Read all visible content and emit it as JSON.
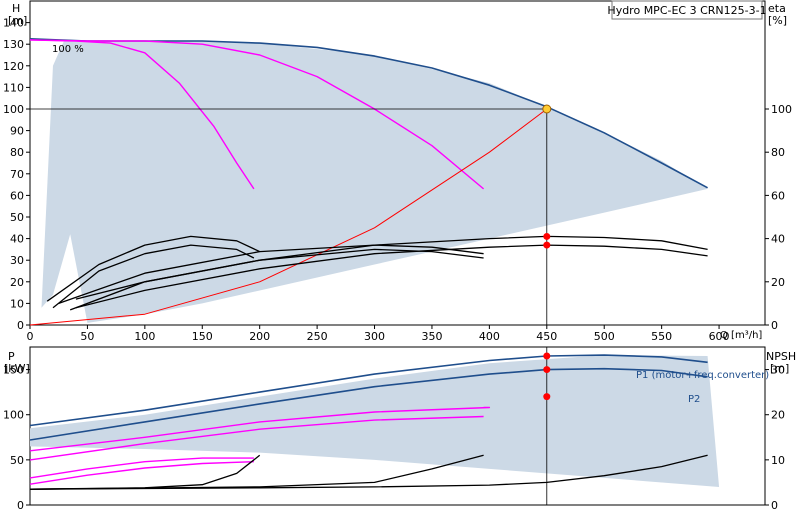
{
  "title": "Hydro MPC-EC 3 CRN125-3-1",
  "colors": {
    "area": "#ccd9e6",
    "area_light": "#e4edf5",
    "max_curve": "#1f4e8c",
    "pump_curve": "#ff00ff",
    "system_curve": "#ff0000",
    "eta_curve": "#000000",
    "op_point": "#ff0000",
    "op_fill": "#ffcc33",
    "grid": "#000000",
    "frame": "#000000"
  },
  "chart_data": [
    {
      "type": "line",
      "name": "head-chart",
      "title": "",
      "xlabel": "Q [m³/h]",
      "ylabel": "H [m]",
      "ylabel_symbol": "H",
      "ylabel_unit": "[m]",
      "y2label_symbol": "eta",
      "y2label_unit": "[%]",
      "xlim": [
        0,
        640
      ],
      "ylim": [
        0,
        150
      ],
      "y2lim": [
        0,
        150
      ],
      "x_ticks": [
        0,
        50,
        100,
        150,
        200,
        250,
        300,
        350,
        400,
        450,
        500,
        550,
        600
      ],
      "y_ticks": [
        0,
        10,
        20,
        30,
        40,
        50,
        60,
        70,
        80,
        90,
        100,
        110,
        120,
        130,
        140
      ],
      "y2_ticks": [
        0,
        20,
        40,
        60,
        80,
        100
      ],
      "annotation": "100 %",
      "operating_point": {
        "x": 450,
        "y": 100
      },
      "eta_points": [
        {
          "x": 450,
          "y": 41
        },
        {
          "x": 450,
          "y": 37
        }
      ],
      "series": [
        {
          "role": "area",
          "x": [
            10,
            20,
            30,
            100,
            150,
            200,
            300,
            400,
            450,
            500,
            550,
            590,
            500,
            400,
            300,
            200,
            150,
            100,
            50,
            35,
            20
          ],
          "y": [
            8,
            120,
            132,
            131.5,
            131.5,
            130.5,
            125,
            112,
            101,
            89,
            76,
            63,
            52,
            40,
            28,
            16,
            10,
            5,
            1,
            42,
            14
          ]
        },
        {
          "role": "max",
          "x": [
            0,
            50,
            100,
            150,
            200,
            250,
            300,
            350,
            400,
            450,
            500,
            550,
            590
          ],
          "y": [
            132.5,
            131.5,
            131.5,
            131.5,
            130.5,
            128.5,
            124.5,
            119,
            111,
            101,
            89,
            75,
            63.5
          ]
        },
        {
          "role": "pump",
          "x": [
            0,
            40,
            70,
            100,
            130,
            160,
            180,
            195
          ],
          "y": [
            132,
            131.5,
            130.5,
            126,
            112,
            92,
            75,
            63
          ]
        },
        {
          "role": "pump",
          "x": [
            0,
            50,
            100,
            150,
            200,
            250,
            300,
            350,
            395
          ],
          "y": [
            132,
            131.5,
            131.5,
            130,
            125,
            115,
            100,
            83,
            63
          ]
        },
        {
          "role": "system",
          "x": [
            0,
            100,
            200,
            300,
            400,
            450
          ],
          "y": [
            0,
            5,
            20,
            45,
            80,
            100
          ]
        },
        {
          "role": "eta",
          "x": [
            15,
            60,
            100,
            140,
            180,
            200
          ],
          "y": [
            11,
            28,
            37,
            41,
            39,
            34
          ]
        },
        {
          "role": "eta",
          "x": [
            20,
            60,
            100,
            140,
            180,
            195
          ],
          "y": [
            8,
            25,
            33,
            37,
            35,
            31
          ]
        },
        {
          "role": "eta",
          "x": [
            25,
            100,
            200,
            300,
            350,
            395
          ],
          "y": [
            10,
            24,
            34,
            37,
            36,
            33
          ]
        },
        {
          "role": "eta",
          "x": [
            35,
            100,
            200,
            300,
            350,
            395
          ],
          "y": [
            7,
            20,
            30,
            35,
            34,
            31
          ]
        },
        {
          "role": "eta",
          "x": [
            40,
            100,
            200,
            300,
            400,
            450,
            500,
            550,
            590
          ],
          "y": [
            12,
            20,
            30,
            37,
            40,
            41,
            40.5,
            39,
            35
          ]
        },
        {
          "role": "eta",
          "x": [
            40,
            100,
            200,
            300,
            400,
            450,
            500,
            550,
            590
          ],
          "y": [
            8,
            16,
            26,
            33,
            36,
            37,
            36.5,
            35,
            32
          ]
        }
      ]
    },
    {
      "type": "line",
      "name": "power-chart",
      "title": "",
      "xlabel": "",
      "ylabel": "P [kW]",
      "ylabel_symbol": "P",
      "ylabel_unit": "[kW]",
      "y2label_symbol": "NPSH",
      "y2label_unit": "[m]",
      "xlim": [
        0,
        640
      ],
      "ylim": [
        0,
        175
      ],
      "y2lim": [
        0,
        35
      ],
      "y_ticks": [
        0,
        50,
        100,
        150
      ],
      "y2_ticks": [
        0,
        10,
        20,
        30
      ],
      "series_labels": [
        "P1 (motor+freq.converter)",
        "P2"
      ],
      "operating_points": [
        {
          "x": 450,
          "y": 165
        },
        {
          "x": 450,
          "y": 150
        },
        {
          "x": 450,
          "y": 24
        }
      ],
      "series": [
        {
          "role": "area",
          "x": [
            0,
            100,
            200,
            300,
            400,
            500,
            590,
            600,
            500,
            400,
            300,
            200,
            100,
            0
          ],
          "y": [
            85,
            100,
            120,
            140,
            157,
            166,
            165,
            20,
            30,
            40,
            50,
            58,
            62,
            65
          ]
        },
        {
          "role": "max",
          "x": [
            0,
            100,
            200,
            300,
            400,
            450,
            500,
            550,
            590
          ],
          "y": [
            88,
            105,
            125,
            145,
            160,
            165,
            166,
            164,
            158
          ]
        },
        {
          "role": "max",
          "x": [
            0,
            100,
            200,
            300,
            400,
            450,
            500,
            550,
            590
          ],
          "y": [
            72,
            92,
            112,
            131,
            145,
            150,
            151,
            149,
            142
          ]
        },
        {
          "role": "pump",
          "x": [
            0,
            100,
            200,
            300,
            400,
            395
          ],
          "y": [
            60,
            75,
            92,
            103,
            108,
            108
          ]
        },
        {
          "role": "pump",
          "x": [
            0,
            100,
            200,
            300,
            395
          ],
          "y": [
            50,
            68,
            84,
            94,
            98
          ]
        },
        {
          "role": "pump",
          "x": [
            0,
            50,
            100,
            150,
            195
          ],
          "y": [
            30,
            40,
            48,
            52,
            52
          ]
        },
        {
          "role": "pump",
          "x": [
            0,
            50,
            100,
            150,
            195
          ],
          "y": [
            23,
            33,
            41,
            46,
            48
          ]
        },
        {
          "role": "npsh",
          "x": [
            0,
            100,
            150,
            180,
            200
          ],
          "y": [
            3.5,
            3.8,
            4.5,
            7,
            11
          ]
        },
        {
          "role": "npsh",
          "x": [
            0,
            200,
            300,
            350,
            395
          ],
          "y": [
            3.5,
            4,
            5,
            8,
            11
          ]
        },
        {
          "role": "npsh",
          "x": [
            0,
            200,
            300,
            400,
            450,
            500,
            550,
            590
          ],
          "y": [
            3.5,
            3.8,
            4,
            4.4,
            5,
            6.5,
            8.5,
            11
          ]
        }
      ]
    }
  ]
}
